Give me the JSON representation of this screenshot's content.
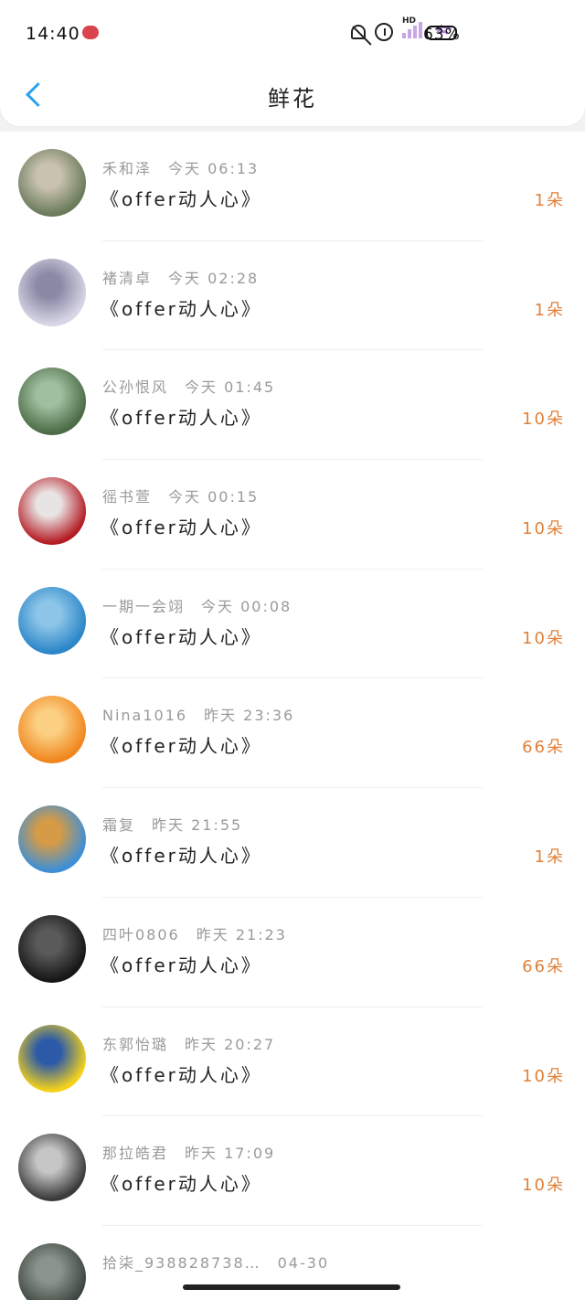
{
  "status_bar": {
    "time": "14:40",
    "battery": "63%"
  },
  "header": {
    "title": "鲜花",
    "back_icon": "chevron-left-icon"
  },
  "accent_color": "#2aa1ef",
  "count_color": "#e0813a",
  "items": [
    {
      "name": "禾和泽",
      "time": "今天 06:13",
      "work": "《offer动人心》",
      "count": "1朵",
      "avatar_color": [
        "#6a7b5a",
        "#c9c2b0"
      ]
    },
    {
      "name": "褚清卓",
      "time": "今天 02:28",
      "work": "《offer动人心》",
      "count": "1朵",
      "avatar_color": [
        "#d8d6e6",
        "#8a8aa6"
      ]
    },
    {
      "name": "公孙恨风",
      "time": "今天 01:45",
      "work": "《offer动人心》",
      "count": "10朵",
      "avatar_color": [
        "#4c6b46",
        "#9fc0a0"
      ]
    },
    {
      "name": "徭书萱",
      "time": "今天 00:15",
      "work": "《offer动人心》",
      "count": "10朵",
      "avatar_color": [
        "#b41c24",
        "#e9e4e4"
      ]
    },
    {
      "name": "一期一会翊",
      "time": "今天 00:08",
      "work": "《offer动人心》",
      "count": "10朵",
      "avatar_color": [
        "#2b86c8",
        "#8cc5e8"
      ]
    },
    {
      "name": "Nina1016",
      "time": "昨天 23:36",
      "work": "《offer动人心》",
      "count": "66朵",
      "avatar_color": [
        "#f1861e",
        "#fbd083"
      ]
    },
    {
      "name": "霜复",
      "time": "昨天 21:55",
      "work": "《offer动人心》",
      "count": "1朵",
      "avatar_color": [
        "#3c8fd8",
        "#d59b47"
      ]
    },
    {
      "name": "四叶0806",
      "time": "昨天 21:23",
      "work": "《offer动人心》",
      "count": "66朵",
      "avatar_color": [
        "#161616",
        "#5a5a5a"
      ]
    },
    {
      "name": "东郭怡璐",
      "time": "昨天 20:27",
      "work": "《offer动人心》",
      "count": "10朵",
      "avatar_color": [
        "#f4d21b",
        "#2c5aa8"
      ]
    },
    {
      "name": "那拉皓君",
      "time": "昨天 17:09",
      "work": "《offer动人心》",
      "count": "10朵",
      "avatar_color": [
        "#3a3a3a",
        "#c6c6c6"
      ]
    },
    {
      "name": "拾柒_938828738…",
      "time": "04-30",
      "work": "",
      "count": "",
      "avatar_color": [
        "#3d4640",
        "#8a948c"
      ]
    }
  ]
}
